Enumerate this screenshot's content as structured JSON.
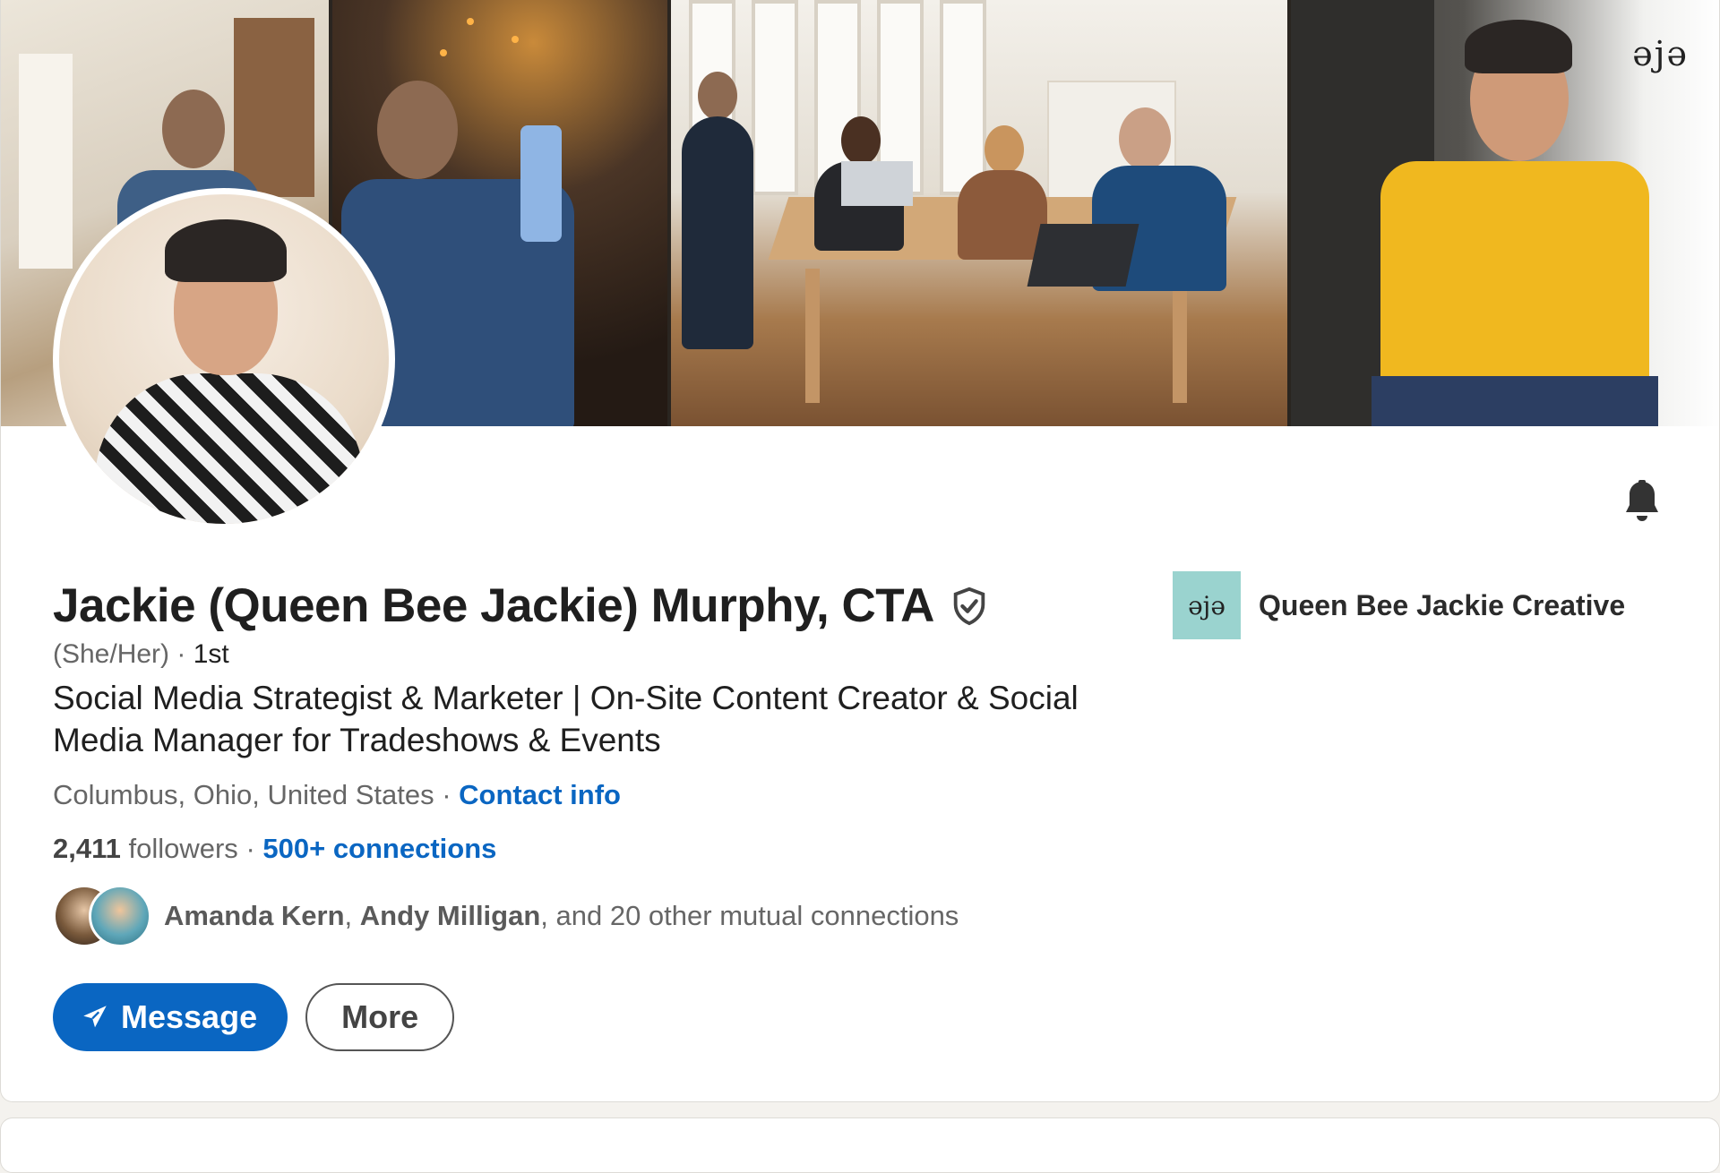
{
  "profile": {
    "name": "Jackie (Queen Bee Jackie) Murphy, CTA",
    "pronouns": "(She/Her)",
    "separator": " · ",
    "degree": "1st",
    "headline": "Social Media Strategist & Marketer | On-Site Content Creator & Social Media Manager for Tradeshows & Events",
    "location": "Columbus, Ohio, United States",
    "contact_info_label": "Contact info",
    "followers_count": "2,411",
    "followers_label": " followers",
    "connections_label": "500+ connections",
    "mutual": {
      "name_1": "Amanda Kern",
      "name_2": "Andy Milligan",
      "rest": ", and 20 other mutual connections"
    }
  },
  "company": {
    "name": "Queen Bee Jackie Creative",
    "logo_text": "ǝjǝ"
  },
  "banner": {
    "watermark": "ǝjǝ"
  },
  "actions": {
    "message_label": "Message",
    "more_label": "More"
  },
  "icons": {
    "verified": "shield-check-icon",
    "bell": "bell-icon",
    "send": "paper-plane-icon"
  },
  "colors": {
    "accent": "#0a66c2",
    "company_logo_bg": "#9ad3cf"
  }
}
